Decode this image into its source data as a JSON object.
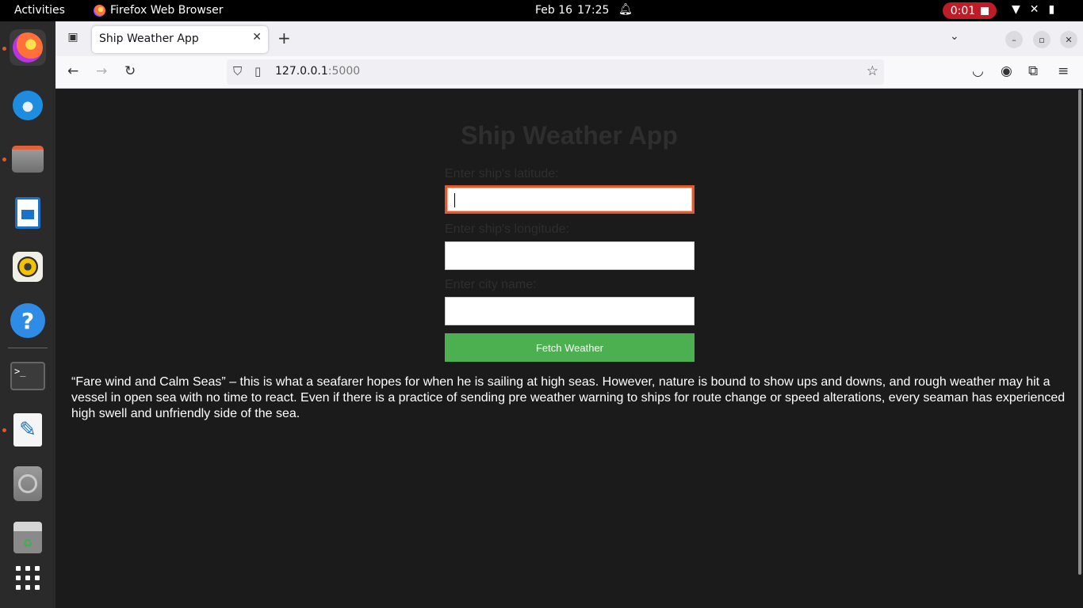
{
  "system_bar": {
    "activities": "Activities",
    "app_name": "Firefox Web Browser",
    "date": "Feb 16",
    "time": "17:25",
    "recording_time": "0:01"
  },
  "dock": {
    "items": [
      "firefox",
      "thunderbird",
      "files",
      "libreoffice-impress",
      "rhythmbox",
      "help",
      "terminal",
      "text-editor",
      "disks",
      "trash",
      "show-apps"
    ]
  },
  "browser": {
    "tab_title": "Ship Weather App",
    "url_host": "127.0.0.1",
    "url_port": ":5000"
  },
  "page": {
    "title": "Ship Weather App",
    "latitude_label": "Enter ship's latitude:",
    "longitude_label": "Enter ship's longitude:",
    "city_label": "Enter city name:",
    "latitude_value": "",
    "longitude_value": "",
    "city_value": "",
    "button_label": "Fetch Weather",
    "quote": "“Fare wind and Calm Seas” – this is what a seafarer hopes for when he is sailing at high seas. However, nature is bound to show ups and downs, and rough weather may hit a vessel in open sea with no time to react. Even if there is a practice of sending pre weather warning to ships for route change or speed alterations, every seaman has experienced high swell and unfriendly side of the sea."
  },
  "colors": {
    "button_bg": "#4caf50",
    "focus_ring": "#e05a2b",
    "page_bg": "#1c1b1b",
    "record_badge": "#c01c28"
  }
}
